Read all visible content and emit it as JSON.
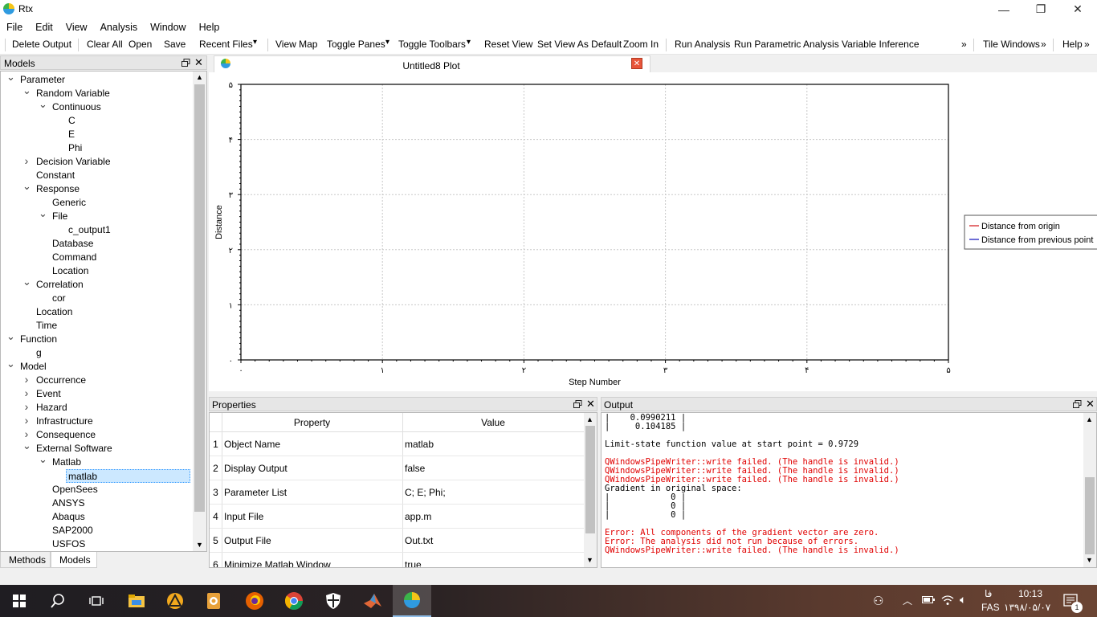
{
  "window": {
    "title": "Rtx",
    "minimize": "—",
    "maximize": "❐",
    "close": "✕"
  },
  "menu": [
    "File",
    "Edit",
    "View",
    "Analysis",
    "Window",
    "Help"
  ],
  "toolbar": {
    "delete_output": "Delete Output",
    "clear_all": "Clear All",
    "open": "Open",
    "save": "Save",
    "recent_files": "Recent Files",
    "view_map": "View Map",
    "toggle_panes": "Toggle Panes",
    "toggle_toolbars": "Toggle Toolbars",
    "reset_view": "Reset View",
    "set_view_default": "Set View As Default",
    "zoom_in": "Zoom In",
    "run_analysis": "Run Analysis",
    "run_parametric": "Run Parametric Analysis",
    "variable_inference": "Variable Inference",
    "tile_windows": "Tile Windows",
    "help": "Help",
    "more": "»",
    "dropdown": "▾"
  },
  "models": {
    "header": "Models",
    "items": [
      {
        "label": "Parameter",
        "depth": 0,
        "chev": "open"
      },
      {
        "label": "Random Variable",
        "depth": 1,
        "chev": "open"
      },
      {
        "label": "Continuous",
        "depth": 2,
        "chev": "open"
      },
      {
        "label": "C",
        "depth": 3,
        "chev": ""
      },
      {
        "label": "E",
        "depth": 3,
        "chev": ""
      },
      {
        "label": "Phi",
        "depth": 3,
        "chev": ""
      },
      {
        "label": "Decision Variable",
        "depth": 1,
        "chev": "closed"
      },
      {
        "label": "Constant",
        "depth": 1,
        "chev": ""
      },
      {
        "label": "Response",
        "depth": 1,
        "chev": "open"
      },
      {
        "label": "Generic",
        "depth": 2,
        "chev": ""
      },
      {
        "label": "File",
        "depth": 2,
        "chev": "open"
      },
      {
        "label": "c_output1",
        "depth": 3,
        "chev": ""
      },
      {
        "label": "Database",
        "depth": 2,
        "chev": ""
      },
      {
        "label": "Command",
        "depth": 2,
        "chev": ""
      },
      {
        "label": "Location",
        "depth": 2,
        "chev": ""
      },
      {
        "label": "Correlation",
        "depth": 1,
        "chev": "open"
      },
      {
        "label": "cor",
        "depth": 2,
        "chev": ""
      },
      {
        "label": "Location",
        "depth": 1,
        "chev": ""
      },
      {
        "label": "Time",
        "depth": 1,
        "chev": ""
      },
      {
        "label": "Function",
        "depth": 0,
        "chev": "open"
      },
      {
        "label": "g",
        "depth": 1,
        "chev": ""
      },
      {
        "label": "Model",
        "depth": 0,
        "chev": "open"
      },
      {
        "label": "Occurrence",
        "depth": 1,
        "chev": "closed"
      },
      {
        "label": "Event",
        "depth": 1,
        "chev": "closed"
      },
      {
        "label": "Hazard",
        "depth": 1,
        "chev": "closed"
      },
      {
        "label": "Infrastructure",
        "depth": 1,
        "chev": "closed"
      },
      {
        "label": "Consequence",
        "depth": 1,
        "chev": "closed"
      },
      {
        "label": "External Software",
        "depth": 1,
        "chev": "open"
      },
      {
        "label": "Matlab",
        "depth": 2,
        "chev": "open"
      },
      {
        "label": "matlab",
        "depth": 3,
        "chev": "",
        "selected": true
      },
      {
        "label": "OpenSees",
        "depth": 2,
        "chev": ""
      },
      {
        "label": "ANSYS",
        "depth": 2,
        "chev": ""
      },
      {
        "label": "Abaqus",
        "depth": 2,
        "chev": ""
      },
      {
        "label": "SAP2000",
        "depth": 2,
        "chev": ""
      },
      {
        "label": "USFOS",
        "depth": 2,
        "chev": ""
      }
    ]
  },
  "bottom_tabs": [
    "Methods",
    "Models"
  ],
  "plot_tab": {
    "title": "Untitled8 Plot"
  },
  "chart_data": {
    "type": "line",
    "title": "",
    "xlabel": "Step Number",
    "ylabel": "Distance",
    "xlim": [
      0,
      5
    ],
    "ylim": [
      0,
      5
    ],
    "x_ticks": [
      "۰",
      "۱",
      "۲",
      "۳",
      "۴",
      "۵"
    ],
    "y_ticks": [
      "۰",
      "۱",
      "۲",
      "۳",
      "۴",
      "۵"
    ],
    "grid": true,
    "legend": "right",
    "series": [
      {
        "name": "Distance from origin",
        "color": "#d62728",
        "x": [],
        "y": []
      },
      {
        "name": "Distance from previous point",
        "color": "#1f1fbf",
        "x": [],
        "y": []
      }
    ]
  },
  "properties": {
    "header": "Properties",
    "col_property": "Property",
    "col_value": "Value",
    "rows": [
      {
        "num": "1",
        "name": "Object Name",
        "value": "matlab"
      },
      {
        "num": "2",
        "name": "Display Output",
        "value": "false"
      },
      {
        "num": "3",
        "name": "Parameter List",
        "value": "C; E; Phi;"
      },
      {
        "num": "4",
        "name": "Input File",
        "value": "app.m"
      },
      {
        "num": "5",
        "name": "Output File",
        "value": "Out.txt"
      },
      {
        "num": "6",
        "name": "Minimize Matlab Window",
        "value": "true"
      }
    ]
  },
  "output": {
    "header": "Output",
    "lines": [
      {
        "text": "|    0.0990211 |",
        "red": false
      },
      {
        "text": "|     0.104185 |",
        "red": false
      },
      {
        "text": "",
        "red": false
      },
      {
        "text": "Limit-state function value at start point = 0.9729",
        "red": false
      },
      {
        "text": "",
        "red": false
      },
      {
        "text": "QWindowsPipeWriter::write failed. (The handle is invalid.)",
        "red": true
      },
      {
        "text": "QWindowsPipeWriter::write failed. (The handle is invalid.)",
        "red": true
      },
      {
        "text": "QWindowsPipeWriter::write failed. (The handle is invalid.)",
        "red": true
      },
      {
        "text": "Gradient in original space:",
        "red": false
      },
      {
        "text": "|            0 |",
        "red": false
      },
      {
        "text": "|            0 |",
        "red": false
      },
      {
        "text": "|            0 |",
        "red": false
      },
      {
        "text": "",
        "red": false
      },
      {
        "text": "Error: All components of the gradient vector are zero.",
        "red": true
      },
      {
        "text": "Error: The analysis did not run because of errors.",
        "red": true
      },
      {
        "text": "QWindowsPipeWriter::write failed. (The handle is invalid.)",
        "red": true
      }
    ]
  },
  "taskbar": {
    "time": "10:13",
    "date": "۱۳۹۸/۰۵/۰۷",
    "lang_top": "فا",
    "lang": "FAS",
    "notification_count": "1"
  }
}
